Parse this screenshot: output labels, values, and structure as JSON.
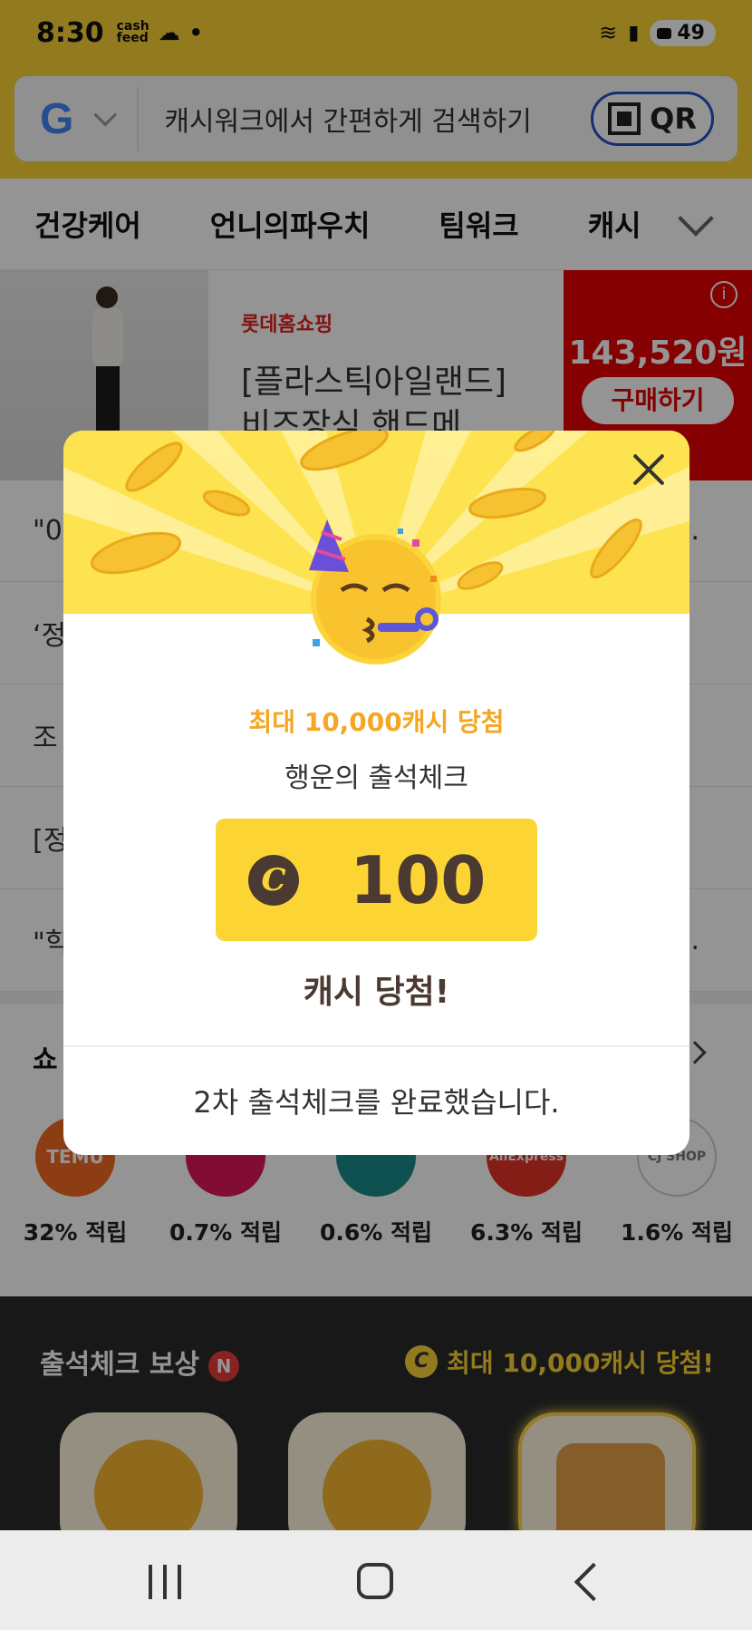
{
  "status_bar": {
    "time": "8:30",
    "app_icon": "cash feed",
    "battery": "49"
  },
  "search": {
    "engine_icon": "G",
    "placeholder": "캐시워크에서 간편하게 검색하기",
    "qr_label": "QR"
  },
  "categories": [
    "건강케어",
    "언니의파우치",
    "팀워크",
    "캐시"
  ],
  "ad": {
    "brand": "롯데홈쇼핑",
    "title": "[플라스틱아일랜드] 비즈장식 핸드메...",
    "price": "143,520원",
    "buy_label": "구매하기",
    "info": "i"
  },
  "news": [
    {
      "prefix": "\"0",
      "ellipsis": "..."
    },
    {
      "prefix": "‘정",
      "ellipsis": ""
    },
    {
      "prefix": "조",
      "ellipsis": ""
    },
    {
      "prefix": "[정",
      "ellipsis": ""
    },
    {
      "prefix": "\"학",
      "ellipsis": "..."
    }
  ],
  "shopping": {
    "title": "쇼",
    "items": [
      {
        "name": "TEMU",
        "rate": "32% 적립",
        "color": "#f26a21"
      },
      {
        "name": "",
        "rate": "0.7% 적립",
        "color": "#e0185b"
      },
      {
        "name": "",
        "rate": "0.6% 적립",
        "color": "#1a8a8a"
      },
      {
        "name": "AliExpress",
        "rate": "6.3% 적립",
        "color": "#e43225"
      },
      {
        "name": "CJ SHOP",
        "rate": "1.6% 적립",
        "color": "#ffffff"
      }
    ]
  },
  "attendance": {
    "title": "출석체크 보상",
    "badge": "N",
    "max_label": "최대 10,000캐시 당첨!",
    "coin_symbol": "C"
  },
  "modal": {
    "sub_title": "최대 10,000캐시 당첨",
    "title": "행운의 출석체크",
    "coin_symbol": "C",
    "amount": "100",
    "result_label": "캐시 당첨!",
    "footer": "2차 출석체크를 완료했습니다."
  },
  "colors": {
    "brand_yellow": "#fcd535",
    "accent_orange": "#f5a623",
    "text_brown": "#4b3a32"
  }
}
